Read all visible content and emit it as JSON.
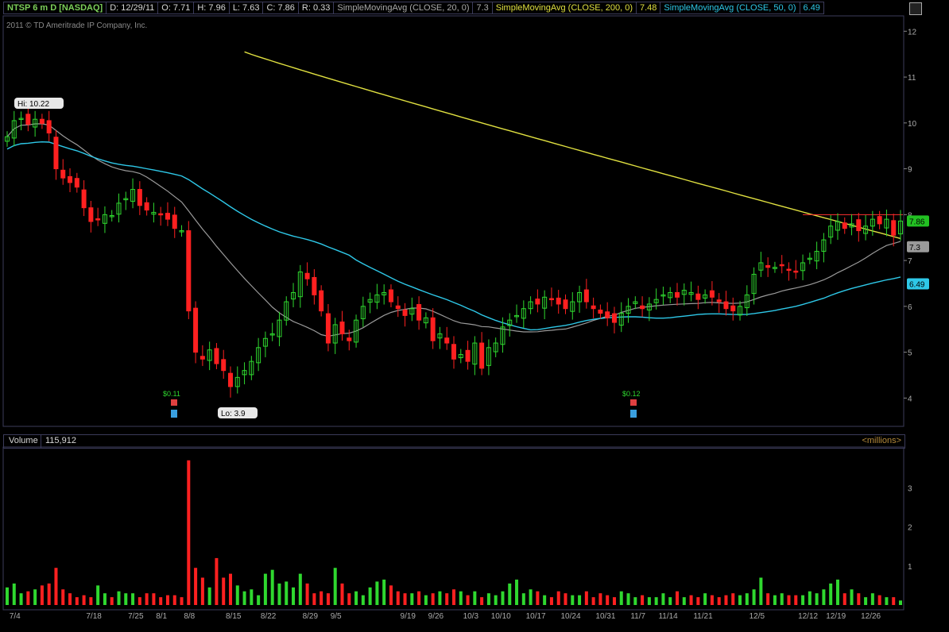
{
  "header": {
    "symbol": "NTSP 6 m D [NASDAQ]",
    "date": "D: 12/29/11",
    "open": "O: 7.71",
    "high": "H: 7.96",
    "low": "L: 7.63",
    "close": "C: 7.86",
    "range": "R: 0.33",
    "sma20_label": "SimpleMovingAvg (CLOSE, 20, 0)",
    "sma20_value": "7.3",
    "sma200_label": "SimpleMovingAvg (CLOSE, 200, 0)",
    "sma200_value": "7.48",
    "sma50_label": "SimpleMovingAvg (CLOSE, 50, 0)",
    "sma50_value": "6.49"
  },
  "copyright": "2011 © TD Ameritrade IP Company, Inc.",
  "volume_header": {
    "label": "Volume",
    "value": "115,912",
    "units": "<millions>"
  },
  "colors": {
    "up": "#2fd82f",
    "down": "#ff2020",
    "sma20": "#9a9a9a",
    "sma50": "#2ec8e8",
    "sma200": "#e0e040",
    "bg": "#000000",
    "grid": "#3b3b5a"
  },
  "chart_data": [
    {
      "type": "candlestick",
      "price_axis": {
        "ylim": [
          3.4,
          12.3
        ],
        "ticks": [
          4,
          5,
          6,
          7,
          8,
          9,
          10,
          11,
          12
        ]
      },
      "x_tick_labels": [
        "7/4",
        "7/18",
        "7/25",
        "8/1",
        "8/8",
        "8/15",
        "8/22",
        "8/29",
        "9/5",
        "9/19",
        "9/26",
        "10/3",
        "10/10",
        "10/17",
        "10/24",
        "10/31",
        "11/7",
        "11/14",
        "11/21",
        "12/5",
        "12/12",
        "12/19",
        "12/26"
      ],
      "closes": [
        9.7,
        10.05,
        10.1,
        9.97,
        10.08,
        9.99,
        9.78,
        9.0,
        8.8,
        8.7,
        8.6,
        8.15,
        7.85,
        7.9,
        8.0,
        7.98,
        8.25,
        8.35,
        8.55,
        8.2,
        8.1,
        8.05,
        8.0,
        7.9,
        7.7,
        7.65,
        5.9,
        5.0,
        4.85,
        5.05,
        4.75,
        4.6,
        4.25,
        4.45,
        4.6,
        4.8,
        5.1,
        5.3,
        5.4,
        5.7,
        6.1,
        6.3,
        6.75,
        6.6,
        6.25,
        5.9,
        5.2,
        5.6,
        5.4,
        5.25,
        5.7,
        6.0,
        6.15,
        6.25,
        6.3,
        6.1,
        5.95,
        5.8,
        5.95,
        5.7,
        5.75,
        5.25,
        5.4,
        5.2,
        4.85,
        4.95,
        4.8,
        5.2,
        4.65,
        5.1,
        5.2,
        5.55,
        5.7,
        5.8,
        5.95,
        6.1,
        6.05,
        6.2,
        6.15,
        6.05,
        5.95,
        6.1,
        6.3,
        6.1,
        5.95,
        5.85,
        5.75,
        5.65,
        5.85,
        6.0,
        6.1,
        5.95,
        6.05,
        6.15,
        6.25,
        6.3,
        6.2,
        6.35,
        6.3,
        6.15,
        6.25,
        6.2,
        6.1,
        5.95,
        5.9,
        6.0,
        6.25,
        6.7,
        6.95,
        6.85,
        6.85,
        6.9,
        6.8,
        6.75,
        6.95,
        7.05,
        7.2,
        7.45,
        7.75,
        7.85,
        7.7,
        7.8,
        7.65,
        7.75,
        7.9,
        7.8,
        7.9,
        7.55,
        7.86
      ],
      "annotations": [
        {
          "text": "Hi: 10.22"
        },
        {
          "text": "Lo: 3.9"
        },
        {
          "text": "$0.11"
        },
        {
          "text": "$0.12"
        }
      ],
      "series": [
        {
          "name": "SimpleMovingAvg (CLOSE, 20, 0)",
          "last": 7.3
        },
        {
          "name": "SimpleMovingAvg (CLOSE, 200, 0)",
          "last": 7.48
        },
        {
          "name": "SimpleMovingAvg (CLOSE, 50, 0)",
          "last": 6.49
        }
      ],
      "resistance_line": 8.0,
      "last_price_label": "7.86",
      "sma20_label": "7.3",
      "sma50_label": "6.49"
    },
    {
      "type": "bar",
      "ylim": [
        0,
        4
      ],
      "ticks": [
        1,
        2,
        3
      ],
      "volumes_millions": [
        0.45,
        0.55,
        0.3,
        0.35,
        0.4,
        0.5,
        0.55,
        0.95,
        0.4,
        0.3,
        0.2,
        0.25,
        0.2,
        0.5,
        0.3,
        0.2,
        0.35,
        0.3,
        0.3,
        0.2,
        0.3,
        0.3,
        0.2,
        0.25,
        0.25,
        0.2,
        3.7,
        0.95,
        0.7,
        0.45,
        1.2,
        0.7,
        0.8,
        0.5,
        0.35,
        0.4,
        0.25,
        0.8,
        0.9,
        0.55,
        0.6,
        0.45,
        0.8,
        0.55,
        0.3,
        0.35,
        0.3,
        0.95,
        0.55,
        0.3,
        0.35,
        0.25,
        0.45,
        0.6,
        0.65,
        0.5,
        0.35,
        0.3,
        0.3,
        0.35,
        0.25,
        0.3,
        0.35,
        0.3,
        0.4,
        0.35,
        0.25,
        0.35,
        0.2,
        0.3,
        0.25,
        0.35,
        0.55,
        0.65,
        0.3,
        0.4,
        0.35,
        0.25,
        0.2,
        0.35,
        0.3,
        0.25,
        0.25,
        0.35,
        0.2,
        0.3,
        0.25,
        0.2,
        0.35,
        0.3,
        0.2,
        0.25,
        0.2,
        0.2,
        0.3,
        0.2,
        0.35,
        0.2,
        0.25,
        0.2,
        0.3,
        0.25,
        0.2,
        0.25,
        0.3,
        0.25,
        0.3,
        0.4,
        0.7,
        0.3,
        0.25,
        0.3,
        0.25,
        0.25,
        0.25,
        0.35,
        0.3,
        0.4,
        0.55,
        0.65,
        0.3,
        0.4,
        0.3,
        0.2,
        0.3,
        0.25,
        0.2,
        0.2,
        0.115
      ]
    }
  ]
}
